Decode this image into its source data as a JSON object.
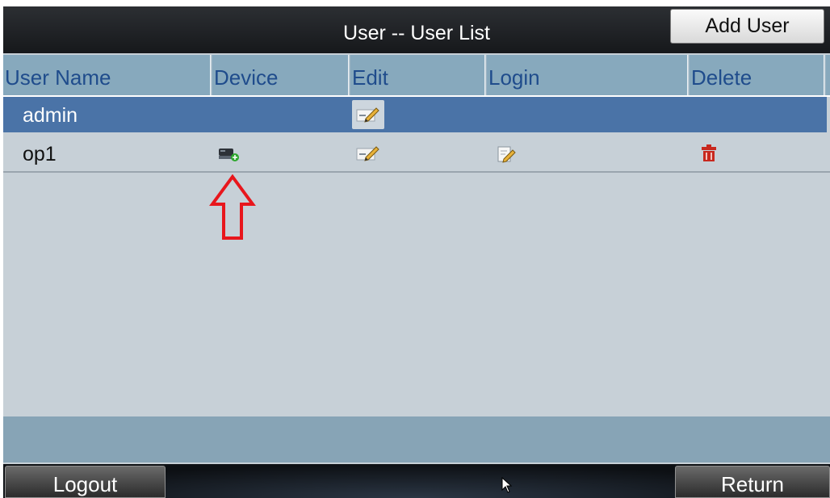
{
  "window": {
    "title": "User -- User List"
  },
  "toolbar": {
    "add_user_label": "Add User"
  },
  "table": {
    "columns": [
      "User Name",
      "Device",
      "Edit",
      "Login",
      "Delete"
    ],
    "rows": [
      {
        "user_name": "admin",
        "selected": true,
        "icons": [
          "edit-icon"
        ]
      },
      {
        "user_name": "op1",
        "selected": false,
        "icons": [
          "device-icon",
          "edit-icon",
          "login-icon",
          "delete-icon"
        ]
      }
    ]
  },
  "footer": {
    "logout_label": "Logout",
    "return_label": "Return"
  },
  "colors": {
    "selected_row": "#4a73a7",
    "header_bg": "#87a9bd",
    "header_text": "#1f4c8c",
    "annotation_arrow": "#e8161c",
    "delete_icon": "#c8281e"
  }
}
